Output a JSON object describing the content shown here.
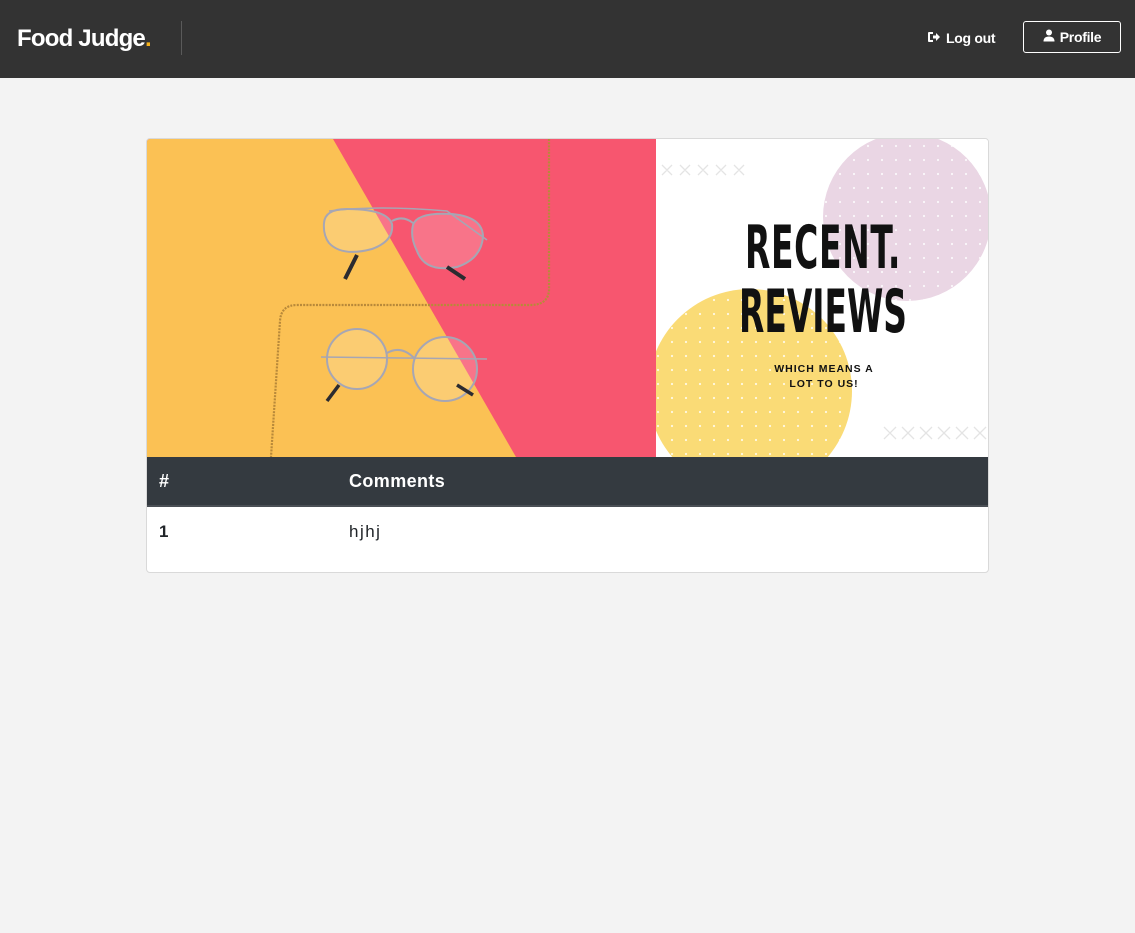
{
  "header": {
    "brand_text": "Food Judge",
    "brand_dot": ".",
    "logout_label": "Log out",
    "logout_icon": "sign-out-icon",
    "profile_label": "Profile",
    "profile_icon": "user-icon",
    "brand_accent_color": "#f6b21b",
    "bg_color": "#333333"
  },
  "banner": {
    "title_line1": "RECENT.",
    "title_line2": "REVIEWS",
    "subtitle_line1": "WHICH MEANS A",
    "subtitle_line2": "LOT TO US!",
    "colors": {
      "yellow": "#fbc154",
      "pink": "#f7566f",
      "lilac": "#ead6e4",
      "sun": "#fadb76"
    }
  },
  "table": {
    "headers": [
      "#",
      "Comments"
    ],
    "rows": [
      {
        "num": "1",
        "comment": "hjhj"
      }
    ]
  }
}
